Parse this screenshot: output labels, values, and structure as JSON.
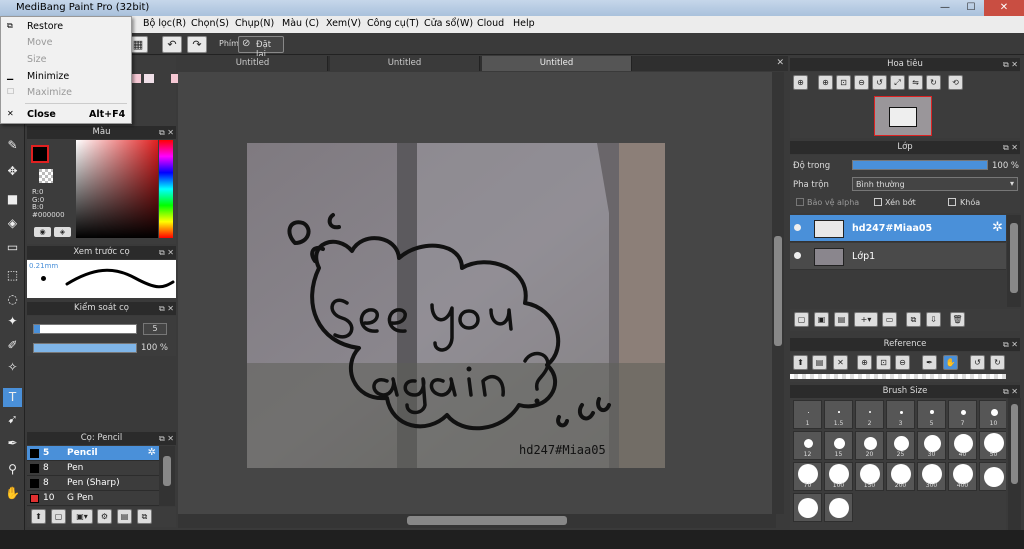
{
  "app": {
    "title": "MediBang Paint Pro (32bit)"
  },
  "window_buttons": {
    "minimize": "—",
    "maximize": "☐",
    "close": "✕"
  },
  "menu": [
    "Bộ lọc(R)",
    "Chọn(S)",
    "Chụp(N)",
    "Màu (C)",
    "Xem(V)",
    "Công cụ(T)",
    "Cửa sổ(W)",
    "Cloud",
    "Help"
  ],
  "system_menu": {
    "restore": "Restore",
    "move": "Move",
    "size": "Size",
    "minimize": "Minimize",
    "maximize": "Maximize",
    "close": "Close",
    "close_shortcut": "Alt+F4"
  },
  "toolbar": {
    "phim_label": "Phím",
    "reset_label": "Đặt lại"
  },
  "tabs": [
    "Untitled",
    "Untitled",
    "Untitled"
  ],
  "color_panel": {
    "title": "Màu",
    "r": "R:0",
    "g": "G:0",
    "b": "B:0",
    "hex": "#000000",
    "fg_color": "#000000"
  },
  "brush_preview": {
    "title": "Xem trước cọ",
    "size": "0.21mm"
  },
  "brush_control": {
    "title": "Kiểm soát cọ",
    "size_value": "5",
    "opacity_value": "100 %",
    "opacity_fraction": 1.0
  },
  "brush_list": {
    "title": "Cọ: Pencil",
    "items": [
      {
        "size": "5",
        "name": "Pencil",
        "color": "#000000"
      },
      {
        "size": "8",
        "name": "Pen",
        "color": "#000000"
      },
      {
        "size": "8",
        "name": "Pen (Sharp)",
        "color": "#000000"
      },
      {
        "size": "10",
        "name": "G Pen",
        "color": "#e03030"
      }
    ]
  },
  "navigator": {
    "title": "Hoa tiêu"
  },
  "layer_panel": {
    "title": "Lớp",
    "opacity_label": "Độ trong",
    "opacity_value": "100 %",
    "blend_label": "Pha trộn",
    "blend_value": "Bình thường",
    "protect_alpha": "Bảo vệ alpha",
    "clipping": "Xén bớt",
    "lock": "Khóa",
    "layers": [
      {
        "name": "hd247#Miaa05",
        "selected": true
      },
      {
        "name": "Lớp1",
        "selected": false
      }
    ]
  },
  "reference": {
    "title": "Reference"
  },
  "brush_size": {
    "title": "Brush Size",
    "sizes": [
      "1",
      "1.5",
      "2",
      "3",
      "5",
      "7",
      "10",
      "12",
      "15",
      "20",
      "25",
      "30",
      "40",
      "50",
      "70",
      "100",
      "150",
      "200",
      "300",
      "400",
      "",
      "",
      ""
    ]
  },
  "canvas": {
    "text_line1": "see you",
    "text_line2": "again ?",
    "watermark": "hd247#Miaa05"
  },
  "colors": {
    "accent": "#4a90d9"
  }
}
